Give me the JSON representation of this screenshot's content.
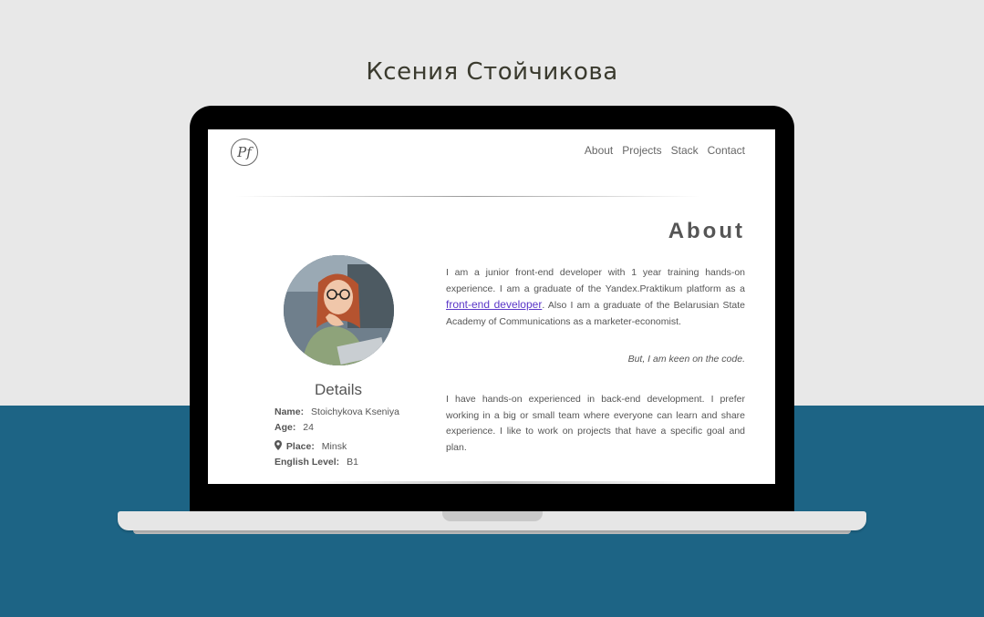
{
  "page": {
    "title": "Ксения Стойчикова"
  },
  "site": {
    "logo_text": "Pf",
    "nav": [
      {
        "label": "About"
      },
      {
        "label": "Projects"
      },
      {
        "label": "Stack"
      },
      {
        "label": "Contact"
      }
    ],
    "about": {
      "title": "About",
      "details_title": "Details",
      "details": {
        "name_label": "Name:",
        "name_value": "Stoichykova Kseniya",
        "age_label": "Age:",
        "age_value": "24",
        "place_label": "Place:",
        "place_value": "Minsk",
        "english_label": "English Level:",
        "english_value": "B1"
      },
      "para1_before": "I am a junior front-end developer with 1 year training hands-on experience. I am a graduate of the Yandex.Praktikum platform as a ",
      "para1_link": "front-end developer",
      "para1_after": ". Also I am a graduate of the Belarusian State Academy of Communications as a marketer-economist.",
      "quote": "But, I am keen on the code.",
      "para2": "I have hands-on experienced in back-end development. I prefer working in a big or small team where everyone can learn and share experience. I like to work on projects that have a specific goal and plan."
    }
  },
  "colors": {
    "background_top": "#e8e8e8",
    "background_bottom": "#1d6485",
    "link": "#5a36c8"
  }
}
